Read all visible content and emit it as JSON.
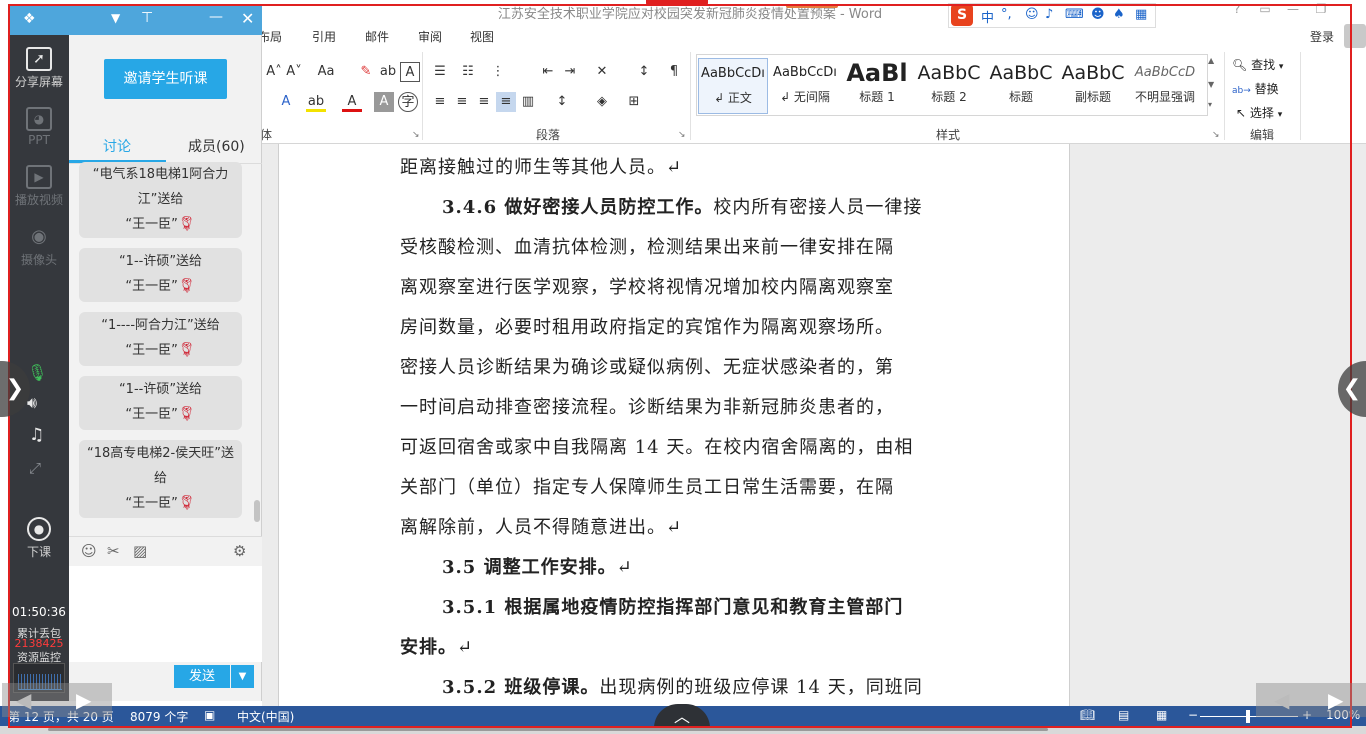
{
  "word": {
    "title": "江苏安全技术职业学院应对校园突发新冠肺炎疫情处置预案 - Word",
    "login": "登录",
    "tabs": [
      "布局",
      "引用",
      "邮件",
      "审阅",
      "视图"
    ],
    "groups": {
      "font_partial": "体",
      "paragraph": "段落",
      "styles": "样式",
      "editing": "编辑"
    },
    "styles": [
      {
        "sample": "AaBbCcDı",
        "name": "↲ 正文"
      },
      {
        "sample": "AaBbCcDı",
        "name": "↲ 无间隔"
      },
      {
        "sample": "AaBl",
        "name": "标题 1"
      },
      {
        "sample": "AaBbC",
        "name": "标题 2"
      },
      {
        "sample": "AaBbC",
        "name": "标题"
      },
      {
        "sample": "AaBbC",
        "name": "副标题"
      },
      {
        "sample": "AaBbCcD",
        "name": "不明显强调"
      }
    ],
    "editing": {
      "find": "查找",
      "replace": "替换",
      "select": "选择"
    },
    "font_size_buttons": [
      "A˄",
      "A˅",
      "Aa"
    ],
    "doc_lines": [
      {
        "bold": "",
        "text": "距离接触过的师生等其他人员。↵"
      },
      {
        "bold": "3.4.6 做好密接人员防控工作。",
        "text": "校内所有密接人员一律接"
      },
      {
        "bold": "",
        "text": "受核酸检测、血清抗体检测，检测结果出来前一律安排在隔"
      },
      {
        "bold": "",
        "text": "离观察室进行医学观察，学校将视情况增加校内隔离观察室"
      },
      {
        "bold": "",
        "text": "房间数量，必要时租用政府指定的宾馆作为隔离观察场所。"
      },
      {
        "bold": "",
        "text": "密接人员诊断结果为确诊或疑似病例、无症状感染者的，第"
      },
      {
        "bold": "",
        "text": "一时间启动排查密接流程。诊断结果为非新冠肺炎患者的，"
      },
      {
        "bold": "",
        "text": "可返回宿舍或家中自我隔离 14 天。在校内宿舍隔离的，由相"
      },
      {
        "bold": "",
        "text": "关部门（单位）指定专人保障师生员工日常生活需要，在隔"
      },
      {
        "bold": "",
        "text": "离解除前，人员不得随意进出。↵"
      },
      {
        "bold": "3.5 调整工作安排。",
        "text": "↵"
      },
      {
        "bold": "3.5.1  根据属地疫情防控指挥部门意见和教育主管部门",
        "text": ""
      },
      {
        "bold": "安排。",
        "text": "↵"
      },
      {
        "bold": "3.5.2 班级停课。",
        "text": "出现病例的班级应停课 14 天，同班同"
      }
    ],
    "status": {
      "page": "第 12 页，共 20 页",
      "words": "8079 个字",
      "language": "中文(中国)",
      "zoom": "100%"
    }
  },
  "classroom": {
    "toolbar": [
      {
        "label": "分享屏幕",
        "icon": "share-screen-icon",
        "enabled": true
      },
      {
        "label": "PPT",
        "icon": "ppt-icon",
        "enabled": false
      },
      {
        "label": "播放视频",
        "icon": "play-video-icon",
        "enabled": false
      },
      {
        "label": "摄像头",
        "icon": "camera-icon",
        "enabled": false
      },
      {
        "label": "下课",
        "icon": "end-class-icon",
        "enabled": true
      }
    ],
    "time": "01:50:36",
    "lost_packets_label": "累计丢包",
    "lost_packets_value": "2138425",
    "resource_monitor": "资源监控",
    "invite_button": "邀请学生听课",
    "tab_discussion": "讨论",
    "tab_members": "成员(60)",
    "messages": [
      {
        "line1": "“电气系18电梯1阿合力",
        "line2": "江”送给",
        "line3": "“王一臣”"
      },
      {
        "line1": "“1--许硕”送给",
        "line2": "",
        "line3": "“王一臣”"
      },
      {
        "line1": "“1----阿合力江”送给",
        "line2": "",
        "line3": "“王一臣”"
      },
      {
        "line1": "“1--许硕”送给",
        "line2": "",
        "line3": "“王一臣”"
      },
      {
        "line1": "“18高专电梯2-侯天旺”送",
        "line2": "给",
        "line3": "“王一臣”"
      }
    ],
    "send_button": "发送"
  },
  "colors": {
    "word_blue": "#2b579a",
    "accent": "#27a7e6",
    "share_frame": "#e02020"
  }
}
